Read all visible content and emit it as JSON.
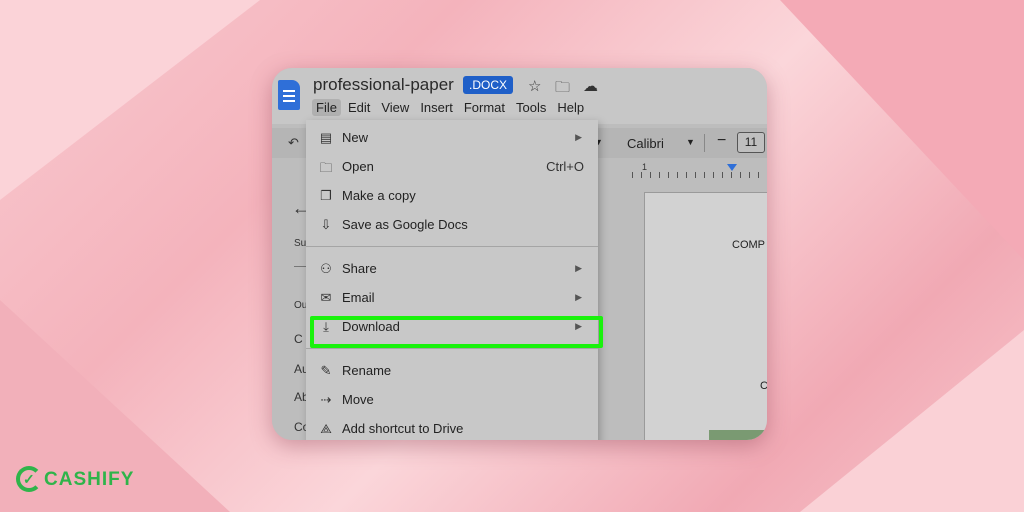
{
  "document": {
    "title": "professional-paper",
    "file_badge": ".DOCX"
  },
  "menubar": [
    "File",
    "Edit",
    "View",
    "Insert",
    "Format",
    "Tools",
    "Help"
  ],
  "toolbar": {
    "font": "Calibri",
    "font_size": "11",
    "minus": "−"
  },
  "ruler": {
    "mark": "1"
  },
  "left_panel": {
    "items": [
      "Su",
      "Ou",
      "C",
      "Au",
      "Ab",
      "Co"
    ]
  },
  "page": {
    "text1": "COMP",
    "text2": "C"
  },
  "file_menu": {
    "items": [
      {
        "label": "New",
        "icon": "doc-icon",
        "glyph": "▤",
        "submenu": true
      },
      {
        "label": "Open",
        "icon": "folder-icon",
        "glyph": "🗀",
        "shortcut": "Ctrl+O"
      },
      {
        "label": "Make a copy",
        "icon": "copy-icon",
        "glyph": "❐"
      },
      {
        "label": "Save as Google Docs",
        "icon": "save-icon",
        "glyph": "⇩"
      },
      {
        "label": "Share",
        "icon": "add-person-icon",
        "glyph": "⚇",
        "submenu": true
      },
      {
        "label": "Email",
        "icon": "mail-icon",
        "glyph": "✉",
        "submenu": true
      },
      {
        "label": "Download",
        "icon": "download-icon",
        "glyph": "⤓",
        "submenu": true,
        "highlighted": true
      },
      {
        "label": "Rename",
        "icon": "pencil-icon",
        "glyph": "✎"
      },
      {
        "label": "Move",
        "icon": "move-folder-icon",
        "glyph": "⇢"
      },
      {
        "label": "Add shortcut to Drive",
        "icon": "drive-shortcut-icon",
        "glyph": "⟁"
      }
    ]
  },
  "brand": {
    "name": "CASHIFY",
    "color": "#2fb44a"
  },
  "highlight_color": "#19f20c"
}
